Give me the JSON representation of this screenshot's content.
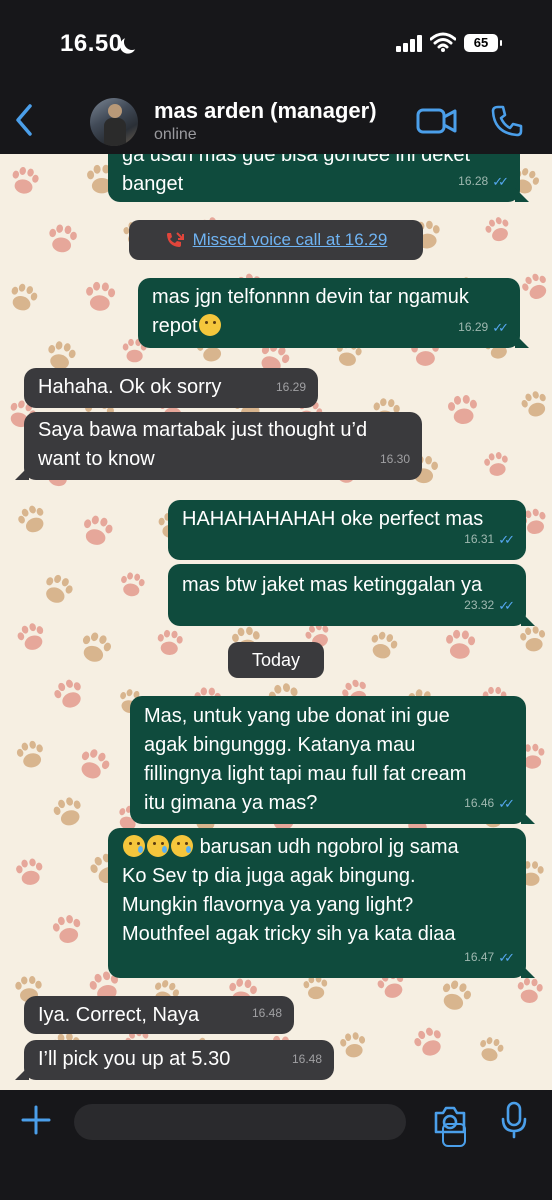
{
  "status_bar": {
    "time": "16.50",
    "battery": "65"
  },
  "header": {
    "contact_name": "mas arden (manager)",
    "contact_status": "online"
  },
  "messages": [
    {
      "dir": "out",
      "lines": [
        "ga usah mas gue bisa gondee ini deket",
        "banget"
      ],
      "time": "16.28"
    },
    {
      "dir": "out",
      "lines": [
        "mas jgn telfonnnn devin tar ngamuk",
        "repot"
      ],
      "time": "16.29"
    },
    {
      "dir": "in",
      "lines": [
        "Hahaha. Ok ok sorry"
      ],
      "time": "16.29"
    },
    {
      "dir": "in",
      "lines": [
        "Saya bawa martabak just thought u’d",
        "want to know"
      ],
      "time": "16.30"
    },
    {
      "dir": "out",
      "lines": [
        "HAHAHAHAHAH oke perfect mas"
      ],
      "time": "16.31"
    },
    {
      "dir": "out",
      "lines": [
        "mas btw jaket mas ketinggalan ya"
      ],
      "time": "23.32"
    },
    {
      "dir": "out",
      "lines": [
        "Mas, untuk yang ube donat ini gue",
        "agak bingunggg. Katanya mau",
        "fillingnya light tapi mau full fat cream",
        "itu gimana ya mas?"
      ],
      "time": "16.46"
    },
    {
      "dir": "out",
      "lines": [
        "barusan udh ngobrol jg sama",
        "Ko Sev tp dia juga agak bingung.",
        "Mungkin flavornya ya yang light?",
        "Mouthfeel agak tricky sih ya kata diaa"
      ],
      "time": "16.47"
    },
    {
      "dir": "in",
      "lines": [
        "Iya. Correct, Naya"
      ],
      "time": "16.48"
    },
    {
      "dir": "in",
      "lines": [
        "I’ll pick you up at 5.30"
      ],
      "time": "16.48"
    }
  ],
  "system": {
    "missed_call": "Missed voice call at 16.29",
    "date_divider": "Today"
  },
  "icons": [
    "back-chevron-icon",
    "video-call-icon",
    "phone-icon",
    "missed-call-icon",
    "plus-icon",
    "sticker-icon",
    "camera-icon",
    "microphone-icon",
    "emoji-weary",
    "emoji-crying"
  ],
  "colors": {
    "outgoing_bubble": "#0f4b3d",
    "incoming_bubble": "#3a3a3d",
    "accent": "#4b9fea",
    "chat_bg": "#f6efe2"
  }
}
